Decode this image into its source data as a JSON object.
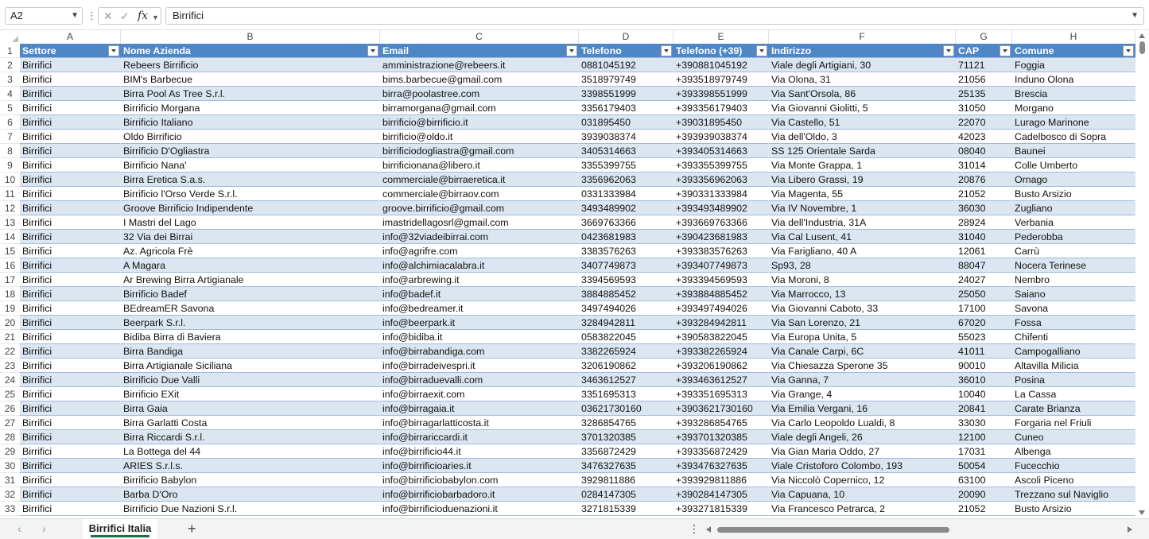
{
  "formula_bar": {
    "cell_ref": "A2",
    "fx_label": "fx",
    "value": "Birrifici"
  },
  "columns": [
    "A",
    "B",
    "C",
    "D",
    "E",
    "F",
    "G",
    "H"
  ],
  "table": {
    "headers": [
      "Settore",
      "Nome Azienda",
      "Email",
      "Telefono",
      "Telefono (+39)",
      "Indirizzo",
      "CAP",
      "Comune"
    ],
    "rows": [
      [
        "Birrifici",
        "Rebeers Birrificio",
        "amministrazione@rebeers.it",
        "0881045192",
        "+390881045192",
        "Viale degli Artigiani, 30",
        "71121",
        "Foggia"
      ],
      [
        "Birrifici",
        "BIM's Barbecue",
        "bims.barbecue@gmail.com",
        "3518979749",
        "+393518979749",
        "Via Olona, 31",
        "21056",
        "Induno Olona"
      ],
      [
        "Birrifici",
        "Birra Pool As Tree S.r.l.",
        "birra@poolastree.com",
        "3398551999",
        "+393398551999",
        "Via Sant'Orsola, 86",
        "25135",
        "Brescia"
      ],
      [
        "Birrifici",
        "Birrificio Morgana",
        "birramorgana@gmail.com",
        "3356179403",
        "+393356179403",
        "Via Giovanni Giolitti, 5",
        "31050",
        "Morgano"
      ],
      [
        "Birrifici",
        "Birrificio Italiano",
        "birrificio@birrificio.it",
        "031895450",
        "+39031895450",
        "Via Castello, 51",
        "22070",
        "Lurago Marinone"
      ],
      [
        "Birrifici",
        "Oldo Birrificio",
        "birrificio@oldo.it",
        "3939038374",
        "+393939038374",
        "Via dell'Oldo, 3",
        "42023",
        "Cadelbosco di Sopra"
      ],
      [
        "Birrifici",
        "Birrificio D'Ogliastra",
        "birrificiodogliastra@gmail.com",
        "3405314663",
        "+393405314663",
        "SS 125 Orientale Sarda",
        "08040",
        "Baunei"
      ],
      [
        "Birrifici",
        "Birrificio Nana'",
        "birrificionana@libero.it",
        "3355399755",
        "+393355399755",
        "Via Monte Grappa, 1",
        "31014",
        "Colle Umberto"
      ],
      [
        "Birrifici",
        "Birra Eretica S.a.s.",
        "commerciale@birraeretica.it",
        "3356962063",
        "+393356962063",
        "Via Libero Grassi, 19",
        "20876",
        "Ornago"
      ],
      [
        "Birrifici",
        "Birrificio l'Orso Verde S.r.l.",
        "commerciale@birraov.com",
        "0331333984",
        "+390331333984",
        "Via Magenta, 55",
        "21052",
        "Busto Arsizio"
      ],
      [
        "Birrifici",
        "Groove Birrificio Indipendente",
        "groove.birrificio@gmail.com",
        "3493489902",
        "+393493489902",
        "Via IV Novembre, 1",
        "36030",
        "Zugliano"
      ],
      [
        "Birrifici",
        "I Mastri del Lago",
        "imastridellagosrl@gmail.com",
        "3669763366",
        "+393669763366",
        "Via dell'Industria, 31A",
        "28924",
        "Verbania"
      ],
      [
        "Birrifici",
        "32 Via dei Birrai",
        "info@32viadeibirrai.com",
        "0423681983",
        "+390423681983",
        "Via Cal Lusent, 41",
        "31040",
        "Pederobba"
      ],
      [
        "Birrifici",
        "Az. Agricola Frè",
        "info@agrifre.com",
        "3383576263",
        "+393383576263",
        "Via Farigliano, 40 A",
        "12061",
        "Carrù"
      ],
      [
        "Birrifici",
        "A Magara",
        "info@alchimiacalabra.it",
        "3407749873",
        "+393407749873",
        "Sp93, 28",
        "88047",
        "Nocera Terinese"
      ],
      [
        "Birrifici",
        "Ar Brewing Birra Artigianale",
        "info@arbrewing.it",
        "3394569593",
        "+393394569593",
        "Via Moroni, 8",
        "24027",
        "Nembro"
      ],
      [
        "Birrifici",
        "Birrificio Badef",
        "info@badef.it",
        "3884885452",
        "+393884885452",
        "Via Marrocco, 13",
        "25050",
        "Saiano"
      ],
      [
        "Birrifici",
        "BEdreamER Savona",
        "info@bedreamer.it",
        "3497494026",
        "+393497494026",
        "Via Giovanni Caboto, 33",
        "17100",
        "Savona"
      ],
      [
        "Birrifici",
        "Beerpark S.r.l.",
        "info@beerpark.it",
        "3284942811",
        "+393284942811",
        "Via San Lorenzo, 21",
        "67020",
        "Fossa"
      ],
      [
        "Birrifici",
        "Bidiba Birra di Baviera",
        "info@bidiba.it",
        "0583822045",
        "+390583822045",
        "Via Europa Unita, 5",
        "55023",
        "Chifenti"
      ],
      [
        "Birrifici",
        "Birra Bandiga",
        "info@birrabandiga.com",
        "3382265924",
        "+393382265924",
        "Via Canale Carpi, 6C",
        "41011",
        "Campogalliano"
      ],
      [
        "Birrifici",
        "Birra Artigianale Siciliana",
        "info@birradeivespri.it",
        "3206190862",
        "+393206190862",
        "Via Chiesazza Sperone 35",
        "90010",
        "Altavilla Milicia"
      ],
      [
        "Birrifici",
        "Birrificio Due Valli",
        "info@birraduevalli.com",
        "3463612527",
        "+393463612527",
        "Via Ganna, 7",
        "36010",
        "Posina"
      ],
      [
        "Birrifici",
        "Birrificio EXit",
        "info@birraexit.com",
        "3351695313",
        "+393351695313",
        "Via Grange, 4",
        "10040",
        "La Cassa"
      ],
      [
        "Birrifici",
        "Birra Gaia",
        "info@birragaia.it",
        "03621730160",
        "+3903621730160",
        "Via Emilia Vergani, 16",
        "20841",
        "Carate Brianza"
      ],
      [
        "Birrifici",
        "Birra Garlatti Costa",
        "info@birragarlatticosta.it",
        "3286854765",
        "+393286854765",
        "Via Carlo Leopoldo Lualdi, 8",
        "33030",
        "Forgaria nel Friuli"
      ],
      [
        "Birrifici",
        "Birra Riccardi S.r.l.",
        "info@birrariccardi.it",
        "3701320385",
        "+393701320385",
        "Viale degli Angeli, 26",
        "12100",
        "Cuneo"
      ],
      [
        "Birrifici",
        "La Bottega del 44",
        "info@birrificio44.it",
        "3356872429",
        "+393356872429",
        "Via Gian Maria Oddo, 27",
        "17031",
        "Albenga"
      ],
      [
        "Birrifici",
        "ARIES S.r.l.s.",
        "info@birrificioaries.it",
        "3476327635",
        "+393476327635",
        "Viale Cristoforo Colombo, 193",
        "50054",
        "Fucecchio"
      ],
      [
        "Birrifici",
        "Birrificio Babylon",
        "info@birrificiobabylon.com",
        "3929811886",
        "+393929811886",
        "Via Niccolò Copernico, 12",
        "63100",
        "Ascoli Piceno"
      ],
      [
        "Birrifici",
        "Barba D'Oro",
        "info@birrificiobarbadoro.it",
        "0284147305",
        "+390284147305",
        "Via Capuana, 10",
        "20090",
        "Trezzano sul Naviglio"
      ],
      [
        "Birrifici",
        "Birrificio Due Nazioni S.r.l.",
        "info@birrificioduenazioni.it",
        "3271815339",
        "+393271815339",
        "Via Francesco Petrarca, 2",
        "21052",
        "Busto Arsizio"
      ]
    ]
  },
  "sheet_tabs": [
    {
      "label": "Birrifici Italia",
      "active": true
    }
  ],
  "colors": {
    "header_fill": "#4f86c6",
    "band_fill": "#dce6f1",
    "active_tab_underline": "#1e7145"
  }
}
